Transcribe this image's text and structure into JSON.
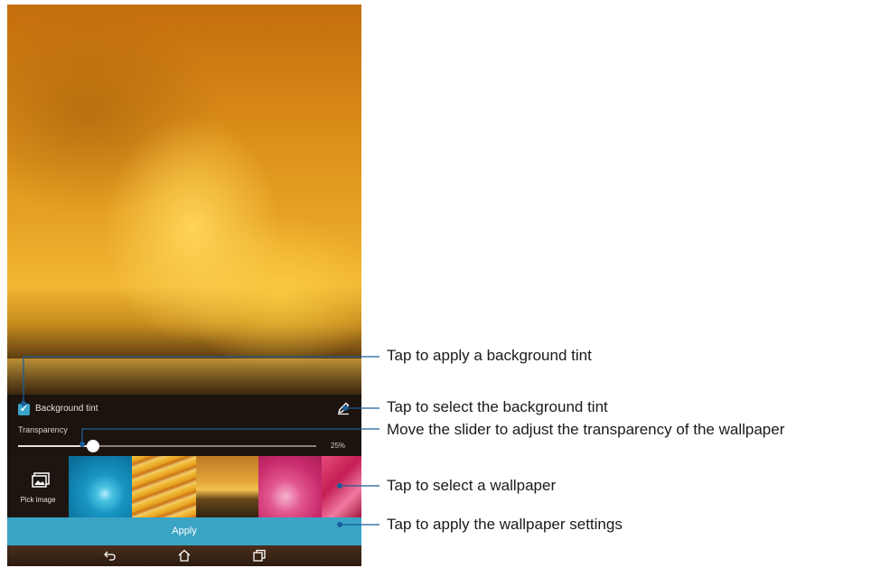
{
  "screen": {
    "tint_checkbox_checked": true,
    "tint_label": "Background tint",
    "transparency_label": "Transparency",
    "transparency_value": "25%",
    "transparency_level_percent": 25,
    "pick_image_label": "Pick image",
    "apply_label": "Apply",
    "colors": {
      "accent": "#3aa4c5",
      "panel": "#1c140e"
    }
  },
  "callouts": [
    {
      "text": "Tap to apply a background tint"
    },
    {
      "text": "Tap to select the background tint"
    },
    {
      "text": "Move the slider to adjust the transparency of the wallpaper"
    },
    {
      "text": "Tap to select a wallpaper"
    },
    {
      "text": "Tap to apply the wallpaper settings"
    }
  ],
  "icons": [
    "checkbox-check-icon",
    "pencil-icon",
    "picture-icon",
    "back-icon",
    "home-icon",
    "recent-apps-icon"
  ]
}
